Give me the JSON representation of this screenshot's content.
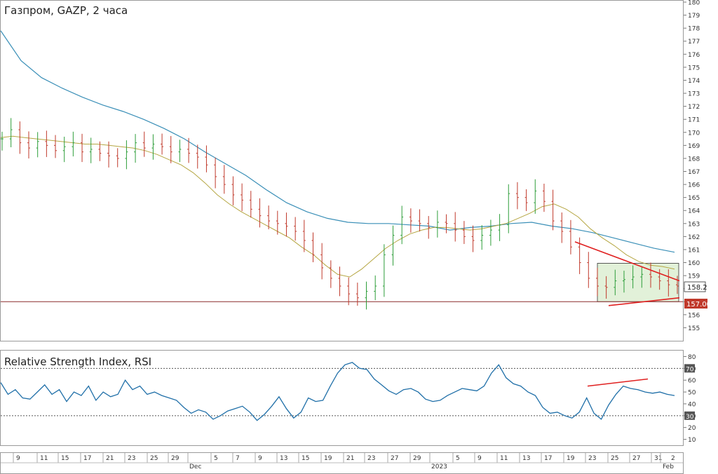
{
  "chart_data": [
    {
      "type": "line",
      "title": "Газпром, GAZP, 2 часа",
      "ylim": [
        154,
        180
      ],
      "yticks": [
        155,
        156,
        157,
        158,
        159,
        160,
        161,
        162,
        163,
        164,
        165,
        166,
        167,
        168,
        169,
        170,
        171,
        172,
        173,
        174,
        175,
        176,
        177,
        178,
        179,
        180
      ],
      "price_marker": "158.2",
      "level_marker": "157.00",
      "horizontal_level": 157.0,
      "series": [
        {
          "role": "price",
          "color": "#2e7d32",
          "values": [
            169.5,
            170.2,
            169.2,
            168.8,
            169.3,
            169.0,
            168.6,
            168.9,
            169.2,
            168.5,
            168.7,
            168.4,
            168.2,
            168.0,
            168.5,
            169.2,
            168.8,
            169.1,
            168.9,
            168.5,
            168.7,
            168.4,
            168.1,
            167.5,
            166.6,
            166.0,
            165.2,
            164.8,
            164.1,
            163.6,
            163.2,
            163.0,
            162.8,
            162.4,
            161.7,
            160.6,
            159.6,
            158.8,
            158.2,
            157.6,
            157.3,
            157.8,
            158.2,
            160.6,
            162.1,
            163.5,
            163.2,
            163.0,
            162.7,
            163.1,
            163.0,
            162.5,
            162.0,
            161.7,
            162.1,
            162.5,
            162.9,
            165.3,
            165.0,
            164.6,
            165.5,
            164.7,
            163.2,
            162.4,
            161.2,
            160.0,
            158.8,
            158.2,
            158.1,
            158.6,
            158.7,
            158.9,
            159.1,
            158.9,
            158.6,
            158.3,
            158.2
          ]
        },
        {
          "role": "moving-average-fast",
          "color": "#b5a642",
          "values": [
            169.6,
            169.7,
            169.6,
            169.5,
            169.4,
            169.3,
            169.2,
            169.1,
            169.1,
            169.0,
            168.9,
            168.8,
            168.6,
            168.3,
            167.9,
            167.5,
            166.9,
            166.1,
            165.2,
            164.5,
            163.9,
            163.4,
            162.9,
            162.4,
            161.9,
            161.2,
            160.6,
            159.8,
            159.1,
            158.9,
            159.5,
            160.3,
            161.1,
            161.7,
            162.2,
            162.5,
            162.7,
            162.7,
            162.6,
            162.5,
            162.6,
            162.8,
            163.0,
            163.4,
            163.8,
            164.3,
            164.5,
            164.1,
            163.5,
            162.6,
            161.9,
            161.3,
            160.6,
            160.1,
            159.8,
            159.7,
            159.5
          ]
        },
        {
          "role": "moving-average-slow",
          "color": "#3a8fb7",
          "values": [
            177.8,
            175.5,
            174.2,
            173.4,
            172.7,
            172.1,
            171.6,
            171.0,
            170.3,
            169.5,
            168.5,
            167.6,
            166.7,
            165.6,
            164.6,
            163.9,
            163.4,
            163.1,
            163.0,
            163.0,
            162.9,
            162.8,
            162.5,
            162.7,
            162.8,
            163.0,
            163.1,
            162.8,
            162.6,
            162.3,
            161.9,
            161.5,
            161.1,
            160.8
          ]
        }
      ],
      "annotations": [
        {
          "kind": "trendline",
          "color": "#e02020"
        },
        {
          "kind": "trendline",
          "color": "#e02020"
        },
        {
          "kind": "rectangle",
          "color": "#cfe8c0"
        }
      ]
    },
    {
      "type": "line",
      "title": "Relative Strength Index, RSI",
      "ylim": [
        5,
        85
      ],
      "yticks": [
        10,
        20,
        30,
        40,
        50,
        60,
        70,
        80
      ],
      "levels": [
        30,
        70
      ],
      "level_labels": [
        "30",
        "70"
      ],
      "series": [
        {
          "role": "rsi",
          "color": "#1f6fa8",
          "values": [
            58,
            48,
            52,
            45,
            44,
            50,
            56,
            48,
            52,
            42,
            50,
            47,
            55,
            43,
            50,
            46,
            48,
            60,
            52,
            55,
            48,
            50,
            47,
            45,
            43,
            37,
            32,
            35,
            33,
            27,
            30,
            34,
            36,
            38,
            33,
            26,
            31,
            38,
            46,
            36,
            28,
            33,
            45,
            42,
            43,
            55,
            66,
            73,
            75,
            70,
            69,
            61,
            56,
            51,
            48,
            52,
            53,
            50,
            44,
            42,
            43,
            47,
            50,
            53,
            52,
            51,
            55,
            66,
            73,
            62,
            57,
            55,
            50,
            47,
            37,
            32,
            33,
            30,
            28,
            33,
            45,
            32,
            27,
            39,
            48,
            55,
            53,
            52,
            50,
            49,
            50,
            48,
            47
          ]
        },
        {
          "role": "divergence-trendline",
          "color": "#e02020"
        }
      ]
    },
    {
      "type": "table",
      "x_axis_labels": [
        "9",
        "11",
        "15",
        "17",
        "21",
        "23",
        "25",
        "29",
        "Dec",
        "5",
        "7",
        "9",
        "13",
        "15",
        "19",
        "21",
        "23",
        "27",
        "29",
        "2023",
        "5",
        "9",
        "11",
        "13",
        "17",
        "19",
        "23",
        "25",
        "27",
        "31",
        "Feb"
      ],
      "x_axis_minor": [
        "2"
      ]
    }
  ]
}
